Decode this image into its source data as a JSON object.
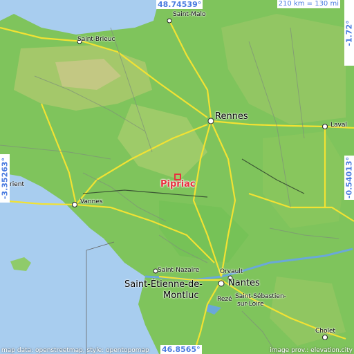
{
  "map": {
    "coords": {
      "top_lat": "48.74539°",
      "bottom_lat": "46.8565°",
      "left_lon": "-3.35263°",
      "right_lon": "-0.54013°",
      "right_top_lat": "-1.72°"
    },
    "scale": "210 km = 130 mi",
    "focus_place": "Pipriac",
    "cities": {
      "saint_malo": "Saint-Malo",
      "saint_brieuc": "Saint-Brieuc",
      "rennes": "Rennes",
      "laval": "Laval",
      "lorient": "rient",
      "vannes": "Vannes",
      "saint_nazaire": "Saint-Nazaire",
      "saint_etienne_1": "Saint-Étienne-de-",
      "saint_etienne_2": "Montluc",
      "orvault": "Orvault",
      "nantes": "Nantes",
      "reze": "Rezé",
      "saint_sebastien_1": "Saint-Sébastien-",
      "saint_sebastien_2": "sur-Loire",
      "cholet": "Cholet"
    },
    "attribution_left": "map data: openstreetmap, style: opentopomap",
    "attribution_right": "image prov.: elevation.city",
    "colors": {
      "sea": "#a8cdef",
      "lowland": "#6cbf52",
      "midland": "#a8c96a",
      "highland": "#d1c88f",
      "road_major": "#f2e233",
      "accent": "#4a7be0",
      "focus": "#e8313f"
    }
  }
}
